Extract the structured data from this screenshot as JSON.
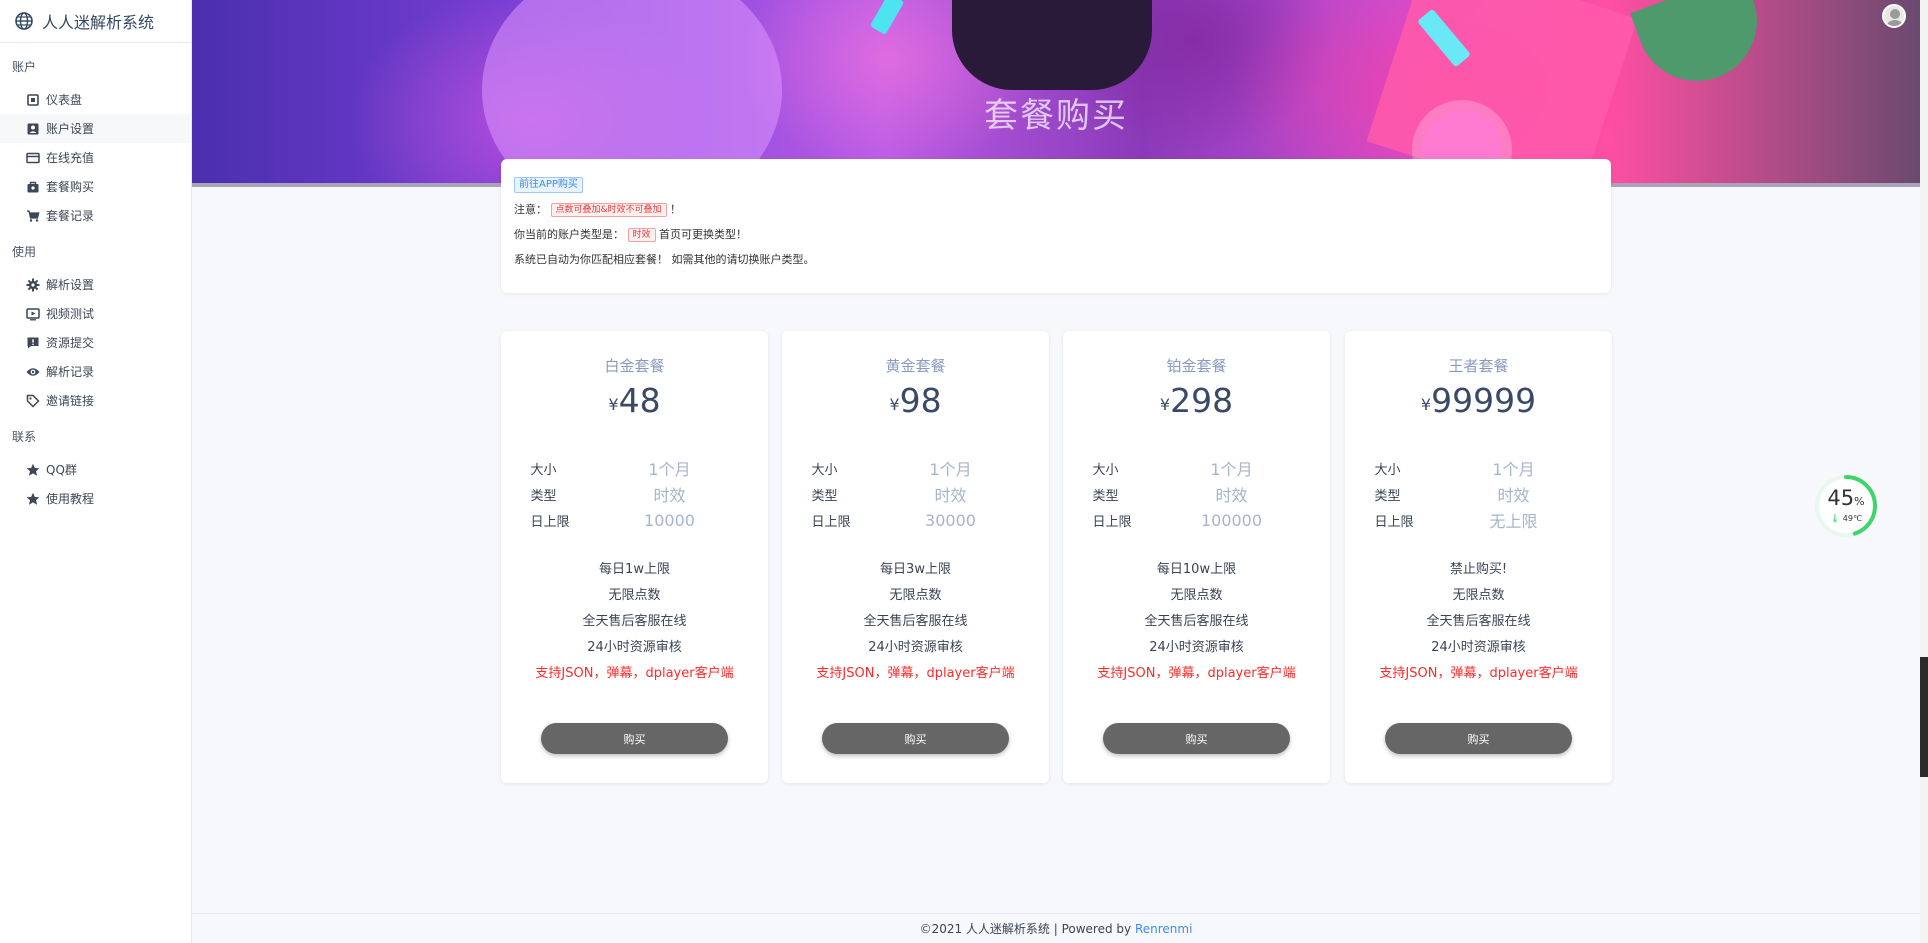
{
  "app": {
    "title": "人人迷解析系统"
  },
  "sidebar": {
    "sections": [
      {
        "title": "账户",
        "items": [
          {
            "label": "仪表盘",
            "icon": "dashboard-icon"
          },
          {
            "label": "账户设置",
            "icon": "user-icon"
          },
          {
            "label": "在线充值",
            "icon": "credit-card-icon"
          },
          {
            "label": "套餐购买",
            "icon": "bag-icon"
          },
          {
            "label": "套餐记录",
            "icon": "cart-icon"
          }
        ]
      },
      {
        "title": "使用",
        "items": [
          {
            "label": "解析设置",
            "icon": "gear-icon"
          },
          {
            "label": "视频测试",
            "icon": "video-icon"
          },
          {
            "label": "资源提交",
            "icon": "alert-icon"
          },
          {
            "label": "解析记录",
            "icon": "eye-icon"
          },
          {
            "label": "邀请链接",
            "icon": "tag-icon"
          }
        ]
      },
      {
        "title": "联系",
        "items": [
          {
            "label": "QQ群",
            "icon": "star-icon"
          },
          {
            "label": "使用教程",
            "icon": "star-icon"
          }
        ]
      }
    ]
  },
  "header": {
    "title": "套餐购买"
  },
  "notice": {
    "app_button": "前往APP购买",
    "note_label": "注意：",
    "note_tag": "点数可叠加&时效不可叠加",
    "note_end": "！",
    "type_label": "你当前的账户类型是：",
    "type_tag": "时效",
    "type_end": "首页可更换类型！",
    "auto_text": "系统已自动为你匹配相应套餐！ 如需其他的请切换账户类型。"
  },
  "packages": [
    {
      "name": "白金套餐",
      "currency": "¥",
      "price": "48",
      "specs": [
        {
          "k": "大小",
          "v": "1个月"
        },
        {
          "k": "类型",
          "v": "时效"
        },
        {
          "k": "日上限",
          "v": "10000"
        }
      ],
      "features": [
        "每日1w上限",
        "无限点数",
        "全天售后客服在线",
        "24小时资源审核"
      ],
      "highlight": "支持JSON，弹幕，dplayer客户端",
      "buy": "购买"
    },
    {
      "name": "黄金套餐",
      "currency": "¥",
      "price": "98",
      "specs": [
        {
          "k": "大小",
          "v": "1个月"
        },
        {
          "k": "类型",
          "v": "时效"
        },
        {
          "k": "日上限",
          "v": "30000"
        }
      ],
      "features": [
        "每日3w上限",
        "无限点数",
        "全天售后客服在线",
        "24小时资源审核"
      ],
      "highlight": "支持JSON，弹幕，dplayer客户端",
      "buy": "购买"
    },
    {
      "name": "铂金套餐",
      "currency": "¥",
      "price": "298",
      "specs": [
        {
          "k": "大小",
          "v": "1个月"
        },
        {
          "k": "类型",
          "v": "时效"
        },
        {
          "k": "日上限",
          "v": "100000"
        }
      ],
      "features": [
        "每日10w上限",
        "无限点数",
        "全天售后客服在线",
        "24小时资源审核"
      ],
      "highlight": "支持JSON，弹幕，dplayer客户端",
      "buy": "购买"
    },
    {
      "name": "王者套餐",
      "currency": "¥",
      "price": "99999",
      "specs": [
        {
          "k": "大小",
          "v": "1个月"
        },
        {
          "k": "类型",
          "v": "时效"
        },
        {
          "k": "日上限",
          "v": "无上限"
        }
      ],
      "features": [
        "禁止购买!",
        "无限点数",
        "全天售后客服在线",
        "24小时资源审核"
      ],
      "highlight": "支持JSON，弹幕，dplayer客户端",
      "buy": "购买"
    }
  ],
  "widget": {
    "percent": "45",
    "percent_unit": "%",
    "temperature": "49℃",
    "ring_fraction": 0.45
  },
  "footer": {
    "copyright": "©2021 人人迷解析系统 | Powered by ",
    "link": "Renrenmi"
  },
  "colors": {
    "accent": "#3a8ee6",
    "highlight": "#ff2a2a",
    "ring": "#3dd66a",
    "button": "#666666"
  }
}
